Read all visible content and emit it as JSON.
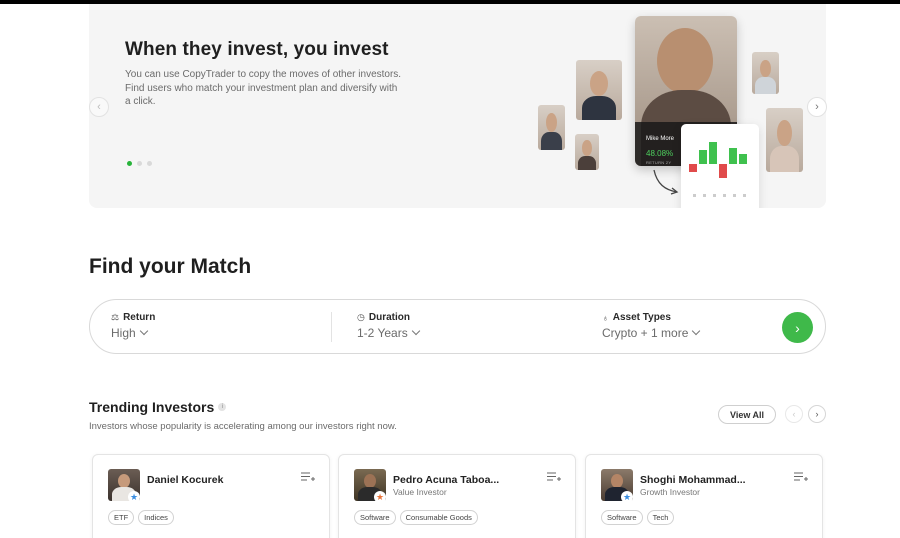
{
  "hero": {
    "title": "When they invest, you invest",
    "description": "You can use CopyTrader to copy the moves of other investors. Find users who match your investment plan and diversify with a click.",
    "featured_name": "Mike More",
    "featured_return": "48.08%",
    "featured_return_label": "RETURN 2Y",
    "slides_total": 3,
    "active_slide": 1
  },
  "match": {
    "title": "Find your Match",
    "fields": [
      {
        "label": "Return",
        "value": "High",
        "icon": "scale-icon"
      },
      {
        "label": "Duration",
        "value": "1-2 Years",
        "icon": "clock-icon"
      },
      {
        "label": "Asset Types",
        "value": "Crypto + 1 more",
        "icon": "asset-icon"
      }
    ],
    "submit_icon": "arrow-right-icon"
  },
  "trending": {
    "title": "Trending Investors",
    "subtitle": "Investors whose popularity is accelerating among our investors right now.",
    "view_all": "View All",
    "investors": [
      {
        "name": "Daniel Kocurek",
        "role": "",
        "badge_color": "#3a8de0",
        "tags": [
          "ETF",
          "Indices"
        ]
      },
      {
        "name": "Pedro Acuna Taboa...",
        "role": "Value Investor",
        "badge_color": "#e8743b",
        "tags": [
          "Software",
          "Consumable Goods"
        ]
      },
      {
        "name": "Shoghi Mohammad...",
        "role": "Growth Investor",
        "badge_color": "#3a8de0",
        "tags": [
          "Software",
          "Tech"
        ]
      }
    ]
  },
  "colors": {
    "accent_green": "#3fb94a",
    "hero_bg": "#f5f5f5"
  }
}
